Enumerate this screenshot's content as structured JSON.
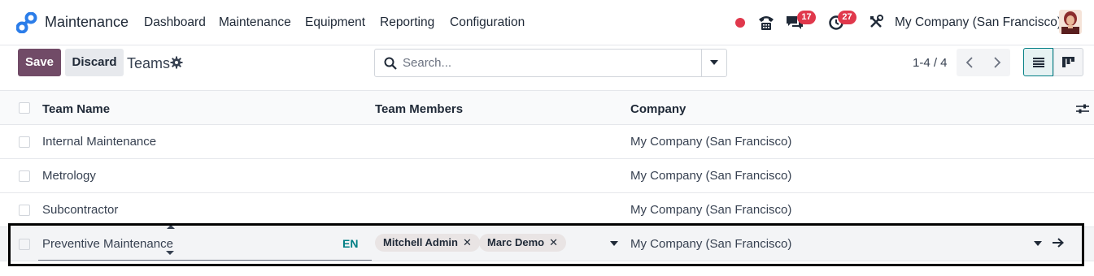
{
  "navbar": {
    "app_name": "Maintenance",
    "menu": [
      "Dashboard",
      "Maintenance",
      "Equipment",
      "Reporting",
      "Configuration"
    ],
    "status_dot_color": "#e0384c",
    "messages_badge": "17",
    "activities_badge": "27",
    "company": "My Company (San Francisco)"
  },
  "control_panel": {
    "save_label": "Save",
    "discard_label": "Discard",
    "breadcrumb": "Teams",
    "search_placeholder": "Search...",
    "pager": "1-4 / 4"
  },
  "table": {
    "columns": [
      "Team Name",
      "Team Members",
      "Company"
    ],
    "rows": [
      {
        "name": "Internal Maintenance",
        "members": [],
        "company": "My Company (San Francisco)"
      },
      {
        "name": "Metrology",
        "members": [],
        "company": "My Company (San Francisco)"
      },
      {
        "name": "Subcontractor",
        "members": [],
        "company": "My Company (San Francisco)"
      }
    ],
    "editing_row": {
      "name": "Preventive Maintenance",
      "lang": "EN",
      "members": [
        "Mitchell Admin",
        "Marc Demo"
      ],
      "company": "My Company (San Francisco)"
    }
  },
  "colors": {
    "brand": "#714b67",
    "badge": "#e0384c",
    "lang_accent": "#017e84"
  }
}
